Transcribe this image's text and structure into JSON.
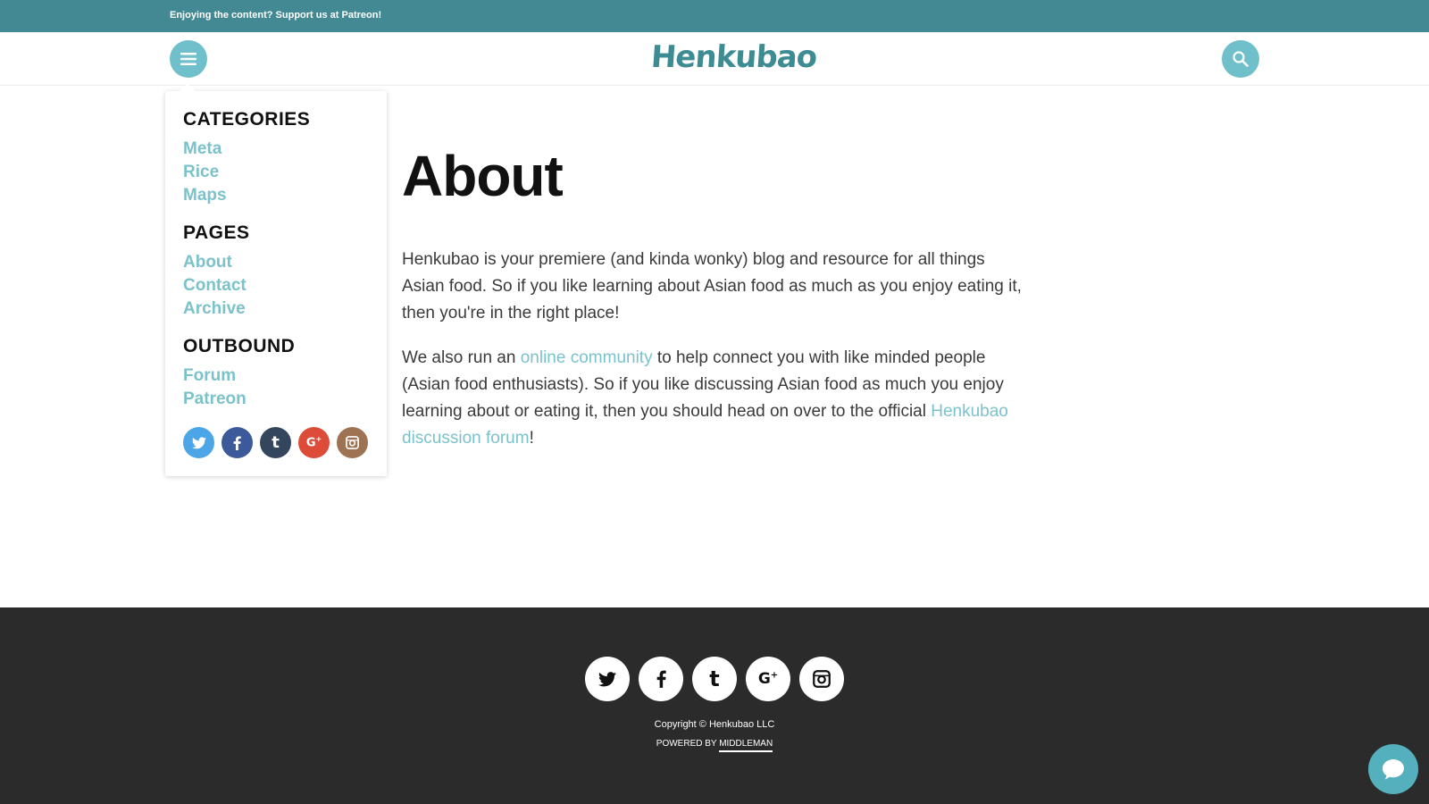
{
  "topbar": {
    "prefix": "Enjoying the content? Support us at ",
    "link": "Patreon",
    "suffix": "!",
    "bg": "#438993"
  },
  "header": {
    "logo": "Henkubao",
    "menu_icon": "hamburger-icon",
    "search_icon": "search-icon"
  },
  "dropdown": {
    "categories_title": "CATEGORIES",
    "categories": [
      "Meta",
      "Rice",
      "Maps"
    ],
    "pages_title": "PAGES",
    "pages": [
      "About",
      "Contact",
      "Archive"
    ],
    "outbound_title": "OUTBOUND",
    "outbound": [
      "Forum",
      "Patreon"
    ],
    "social": [
      {
        "name": "twitter",
        "color": "#4ba5e6"
      },
      {
        "name": "facebook",
        "color": "#3c5a9a"
      },
      {
        "name": "tumblr",
        "color": "#34465d"
      },
      {
        "name": "google-plus",
        "color": "#dd4b39"
      },
      {
        "name": "instagram",
        "color": "#9d7353"
      }
    ]
  },
  "main": {
    "title": "About",
    "p1": "Henkubao is your premiere (and kinda wonky) blog and resource for all things Asian food. So if you like learning about Asian food as much as you enjoy eating it, then you're in the right place!",
    "p2_a": "We also run an ",
    "p2_link1": "online community",
    "p2_b": " to help connect you with like minded people (Asian food enthusiasts). So if you like discussing Asian food as much you enjoy learning about or eating it, then you should head on over to the official ",
    "p2_link2": "Henkubao discussion forum",
    "p2_c": "!"
  },
  "footer": {
    "social": [
      "twitter-icon",
      "facebook-icon",
      "tumblr-icon",
      "google-plus-icon",
      "instagram-icon"
    ],
    "copyright": "Copyright © Henkubao LLC",
    "powered_prefix": "POWERED BY ",
    "powered_link": "MIDDLEMAN"
  },
  "accent_color": "#7bc2cb",
  "chat_icon": "chat-icon"
}
